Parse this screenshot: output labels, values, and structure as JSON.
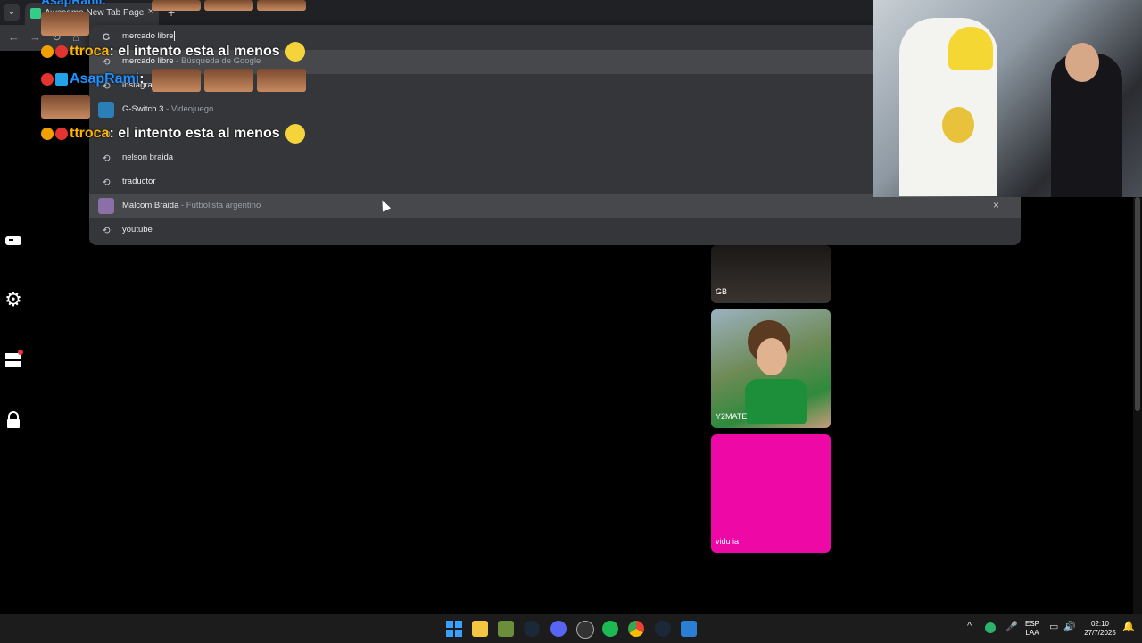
{
  "browser": {
    "tab_title": "Awesome New Tab Page",
    "tab_close": "×",
    "new_tab": "+",
    "tab_list": "⌄",
    "back": "←",
    "forward": "→",
    "reload": "↻",
    "home": "⌂"
  },
  "omnibox": {
    "input_icon": "G",
    "query": "mercado libre",
    "suggestions": [
      {
        "icon": "history-icon",
        "text": "mercado libre",
        "sub": " - Búsqueda de Google"
      },
      {
        "icon": "history-icon",
        "text": "instagra",
        "sub": ""
      },
      {
        "icon": "game-thumb",
        "text": "G-Switch 3",
        "sub": " - Videojuego"
      },
      {
        "icon": "history-icon",
        "text": "",
        "sub": ""
      },
      {
        "icon": "history-icon",
        "text": "nelson braida",
        "sub": ""
      },
      {
        "icon": "history-icon",
        "text": "traductor",
        "sub": ""
      },
      {
        "icon": "person-thumb",
        "text": "Malcom Braida",
        "sub": " - Futbolista argentino"
      },
      {
        "icon": "history-icon",
        "text": "youtube",
        "sub": ""
      }
    ],
    "remove": "×"
  },
  "chat": {
    "line1_user": "ttroca",
    "line1_text": "el intento esta al menos",
    "line2_user": "AsapRami",
    "line3_user": "ttroca",
    "line3_text": "el intento esta al menos",
    "top_partial_user": "AsapRami:",
    "colon": ":"
  },
  "tiles": [
    {
      "label": "GB",
      "color": "#2a2624"
    },
    {
      "label": "Y2MATE",
      "color": "#5d7f3a"
    },
    {
      "label": "vidu ia",
      "color": "#ee08a6"
    }
  ],
  "tray": {
    "lang_top": "ESP",
    "lang_bottom": "LAA",
    "time": "02:10",
    "date": "27/7/2025",
    "chevron": "^"
  },
  "colors": {
    "chat_user_1": "#ffb400",
    "chat_user_2": "#1e90ff",
    "omnibox_bg": "#35363a",
    "tile_pink": "#ee08a6"
  }
}
